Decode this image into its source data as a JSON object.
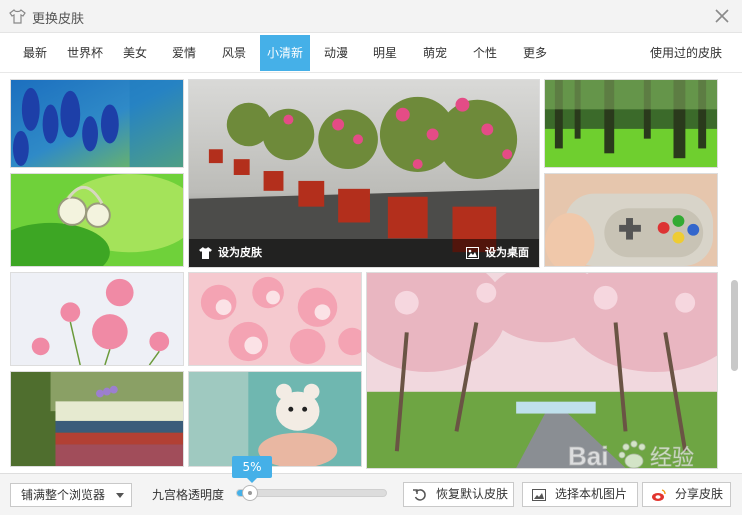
{
  "window": {
    "title": "更换皮肤",
    "logo_icon": "tshirt-icon",
    "close_icon": "close-icon"
  },
  "tabs": [
    {
      "label": "最新"
    },
    {
      "label": "世界杯"
    },
    {
      "label": "美女"
    },
    {
      "label": "爱情"
    },
    {
      "label": "风景"
    },
    {
      "label": "小清新",
      "active": true
    },
    {
      "label": "动漫"
    },
    {
      "label": "明星"
    },
    {
      "label": "萌宠"
    },
    {
      "label": "个性"
    },
    {
      "label": "更多"
    }
  ],
  "used_skins_link": "使用过的皮肤",
  "featured_overlay": {
    "set_skin": "设为皮肤",
    "set_desktop": "设为桌面"
  },
  "bottom": {
    "fill_mode": "铺满整个浏览器",
    "opacity_label": "九宫格透明度",
    "opacity_value": "5%",
    "restore_default": "恢复默认皮肤",
    "choose_local": "选择本机图片",
    "share_skin": "分享皮肤"
  },
  "watermark": {
    "brand_a": "Bai",
    "brand_b": "经验"
  },
  "colors": {
    "accent": "#45b0e8",
    "overlay": "#000000"
  }
}
